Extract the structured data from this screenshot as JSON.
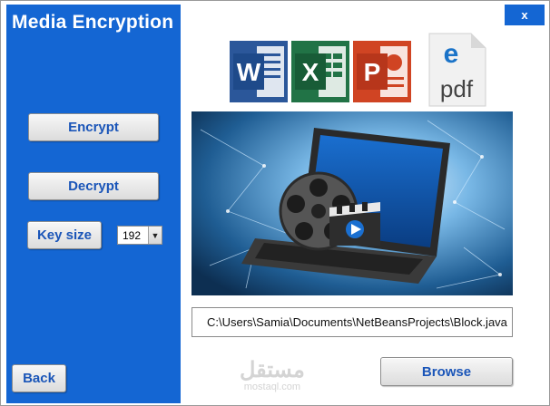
{
  "window": {
    "title": "Media Encryption",
    "close_label": "x"
  },
  "sidebar": {
    "encrypt_label": "Encrypt",
    "decrypt_label": "Decrypt",
    "keysize_label": "Key size",
    "keysize_value": "192",
    "back_label": "Back"
  },
  "file_types": [
    {
      "name": "word-icon",
      "letter": "W",
      "color": "#2b579a"
    },
    {
      "name": "excel-icon",
      "letter": "X",
      "color": "#217346"
    },
    {
      "name": "powerpoint-icon",
      "letter": "P",
      "color": "#d04423"
    },
    {
      "name": "pdf-icon",
      "letter": "e",
      "text": "pdf",
      "color": "#1a73c8"
    }
  ],
  "main": {
    "file_path": "C:\\Users\\Samia\\Documents\\NetBeansProjects\\Block.java",
    "browse_label": "Browse"
  },
  "watermark": {
    "arabic": "مستقل",
    "latin": "mostaql.com"
  },
  "colors": {
    "sidebar": "#1466d3",
    "button_text": "#1a55b8"
  }
}
